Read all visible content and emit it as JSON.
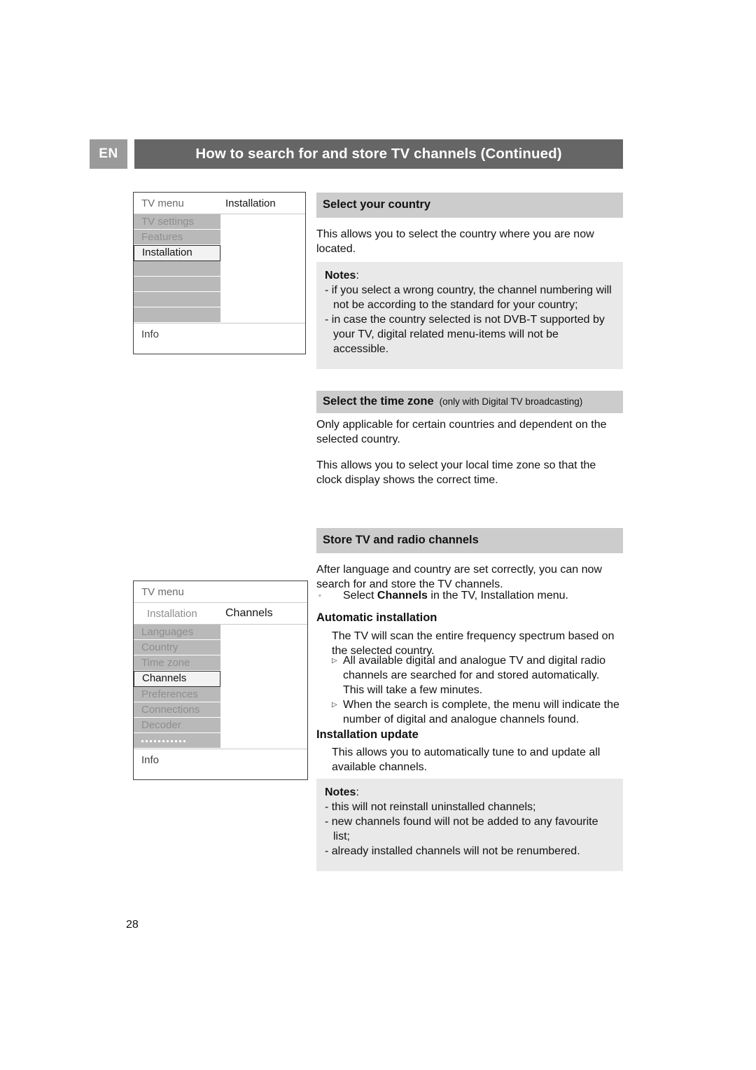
{
  "header": {
    "language_badge": "EN",
    "title": "How to search for and store TV channels  (Continued)"
  },
  "page_number": "28",
  "tv_menu_1": {
    "top_left": "TV menu",
    "top_right": "Installation",
    "items": [
      "TV settings",
      "Features",
      "Installation",
      "",
      "",
      "",
      ""
    ],
    "selected_index": 2,
    "info_label": "Info"
  },
  "tv_menu_2": {
    "top_left": "TV menu",
    "sub_left": "Installation",
    "sub_right": "Channels",
    "items": [
      "Languages",
      "Country",
      "Time zone",
      "Channels",
      "Preferences",
      "Connections",
      "Decoder",
      "............"
    ],
    "selected_index": 3,
    "dots_index": 7,
    "info_label": "Info"
  },
  "sections": {
    "select_country": {
      "heading": "Select your country",
      "paragraph": "This allows you to select the country where you are now located.",
      "notes": {
        "title": "Notes",
        "colon": ":",
        "items": [
          "- if you select a wrong country, the channel numbering will not be according to the standard for your country;",
          "- in case the country selected is not DVB-T supported by your TV, digital related menu-items will not be accessible."
        ]
      }
    },
    "time_zone": {
      "heading": "Select the time zone",
      "qualifier": "(only with Digital TV broadcasting)",
      "paragraph_1": "Only applicable for certain countries and dependent on the selected country.",
      "paragraph_2": "This allows you to select your local time zone so that the clock display shows the correct time."
    },
    "store_channels": {
      "heading": "Store TV and radio channels",
      "paragraph": "After language and country are set correctly, you can now search for and store the TV channels.",
      "bullet_circle": {
        "marker": "circle-bullet",
        "text_before": "Select ",
        "text_bold": "Channels",
        "text_after": " in the TV, Installation menu."
      },
      "automatic_installation": {
        "heading": "Automatic installation",
        "paragraph": "The TV will scan the entire frequency spectrum based on the selected country.",
        "bullets": [
          "All available digital and analogue TV and digital radio channels are searched for and stored automatically. This will take a few minutes.",
          "When the search is complete, the menu will indicate the number of digital and analogue channels found."
        ],
        "bullet_marker": "triangle-right-bullet"
      },
      "installation_update": {
        "heading": "Installation update",
        "paragraph": "This allows you to automatically tune to and update all available channels.",
        "notes": {
          "title": "Notes",
          "colon": ":",
          "items": [
            "- this will not reinstall uninstalled channels;",
            "- new channels found will not be added to any favourite list;",
            "- already installed channels will not be renumbered."
          ]
        }
      }
    }
  }
}
